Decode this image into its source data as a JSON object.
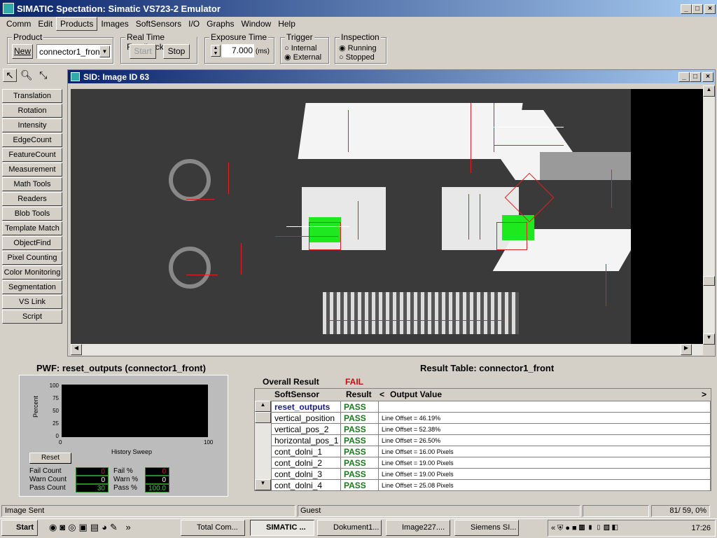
{
  "window": {
    "title": "SIMATIC Spectation: Simatic VS723-2 Emulator"
  },
  "menu": [
    "Comm",
    "Edit",
    "Products",
    "Images",
    "SoftSensors",
    "I/O",
    "Graphs",
    "Window",
    "Help"
  ],
  "toolbar": {
    "product_group": "Product",
    "new_label": "New",
    "product_value": "connector1_front",
    "feedback_group": "Real Time Feedback",
    "start_label": "Start",
    "stop_label": "Stop",
    "exposure_group": "Exposure Time",
    "exposure_value": "7.000",
    "exposure_unit": "(ms)",
    "trigger_group": "Trigger",
    "trigger_options": [
      "Internal",
      "External"
    ],
    "trigger_selected": "External",
    "inspection_group": "Inspection",
    "inspection_options": [
      "Running",
      "Stopped"
    ],
    "inspection_selected": "Running"
  },
  "tools": [
    "Translation",
    "Rotation",
    "Intensity",
    "EdgeCount",
    "FeatureCount",
    "Measurement",
    "Math Tools",
    "Readers",
    "Blob Tools",
    "Template Match",
    "ObjectFind",
    "Pixel Counting",
    "Color Monitoring",
    "Segmentation",
    "VS Link",
    "Script"
  ],
  "image_window": {
    "title": "SID: Image ID 63"
  },
  "pwf": {
    "title": "PWF: reset_outputs (connector1_front)",
    "ylabel": "Percent",
    "xlabel": "History Sweep",
    "yticks": [
      "100",
      "75",
      "50",
      "25",
      "0"
    ],
    "xticks": [
      "0",
      "100"
    ],
    "reset_label": "Reset",
    "stats": [
      {
        "label": "Fail Count",
        "value": "0",
        "color": "#d02020"
      },
      {
        "label": "Warn Count",
        "value": "0",
        "color": "#ffffff"
      },
      {
        "label": "Pass Count",
        "value": "30",
        "color": "#30d030"
      }
    ],
    "pct": [
      {
        "label": "Fail %",
        "value": "0",
        "color": "#d02020"
      },
      {
        "label": "Warn %",
        "value": "0",
        "color": "#ffffff"
      },
      {
        "label": "Pass %",
        "value": "100.0",
        "color": "#30d030"
      }
    ]
  },
  "results": {
    "title": "Result Table: connector1_front",
    "overall_label": "Overall Result",
    "overall_value": "FAIL",
    "headers": [
      "SoftSensor",
      "Result",
      "<",
      "Output Value",
      ">"
    ],
    "rows": [
      {
        "name": "reset_outputs",
        "result": "PASS",
        "value": ""
      },
      {
        "name": "vertical_position",
        "result": "PASS",
        "value": "Line Offset = 46.19%"
      },
      {
        "name": "vertical_pos_2",
        "result": "PASS",
        "value": "Line Offset = 52.38%"
      },
      {
        "name": "horizontal_pos_1",
        "result": "PASS",
        "value": "Line Offset = 26.50%"
      },
      {
        "name": "cont_dolni_1",
        "result": "PASS",
        "value": "Line Offset = 16.00 Pixels"
      },
      {
        "name": "cont_dolni_2",
        "result": "PASS",
        "value": "Line Offset = 19.00 Pixels"
      },
      {
        "name": "cont_dolni_3",
        "result": "PASS",
        "value": "Line Offset = 19.00 Pixels"
      },
      {
        "name": "cont_dolni_4",
        "result": "PASS",
        "value": "Line Offset = 25.08 Pixels"
      }
    ]
  },
  "status": {
    "message": "Image Sent",
    "user": "Guest",
    "coords": "81/ 59, 0%"
  },
  "taskbar": {
    "start": "Start",
    "tasks": [
      "Total Com...",
      "SIMATIC ...",
      "Dokument1...",
      "Image227....",
      "Siemens SI..."
    ],
    "clock": "17:26"
  }
}
